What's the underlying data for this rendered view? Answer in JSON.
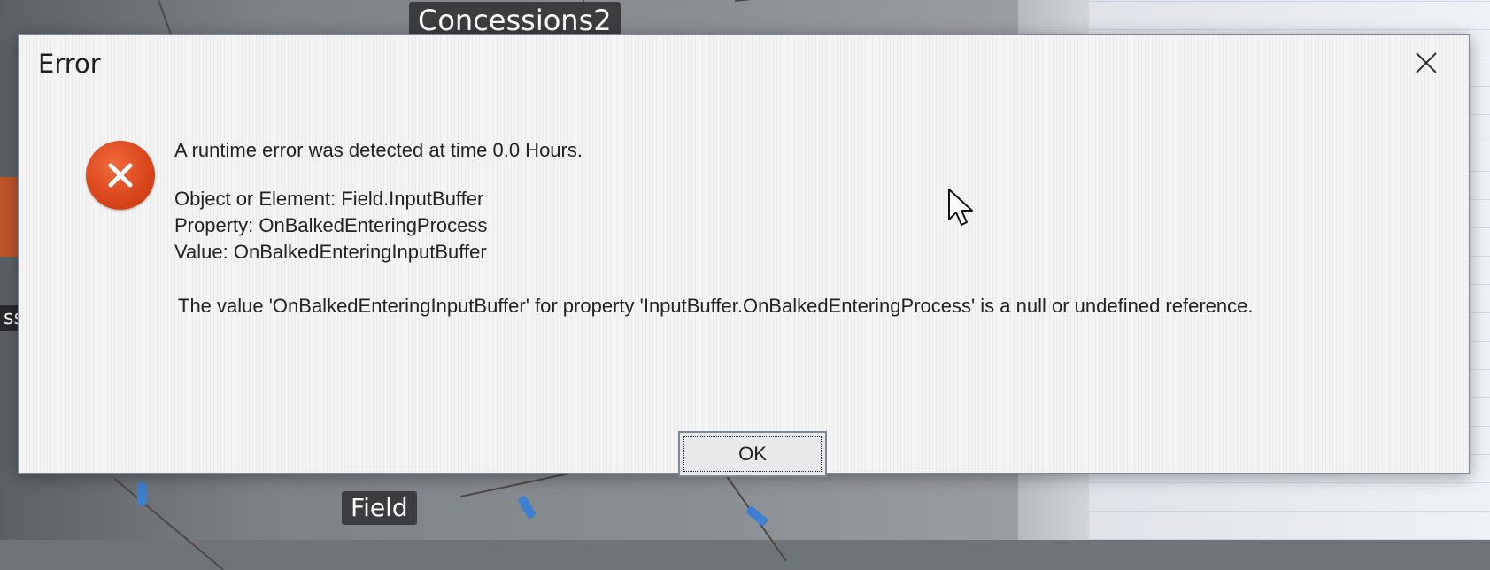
{
  "background": {
    "labels": {
      "top": "Concessions2",
      "bottom": "Field",
      "side": "ss"
    }
  },
  "dialog": {
    "title": "Error",
    "close_icon": "close-icon",
    "error_icon": "error-icon",
    "headline": "A runtime error was detected at time 0.0 Hours.",
    "details": {
      "object": "Object or Element: Field.InputBuffer",
      "property": "Property: OnBalkedEnteringProcess",
      "value": "Value: OnBalkedEnteringInputBuffer"
    },
    "explanation": "The value 'OnBalkedEnteringInputBuffer' for property 'InputBuffer.OnBalkedEnteringProcess' is a null or undefined reference.",
    "ok_label": "OK"
  },
  "colors": {
    "error_red": "#d9441b",
    "dialog_bg": "#f3f4f3"
  }
}
